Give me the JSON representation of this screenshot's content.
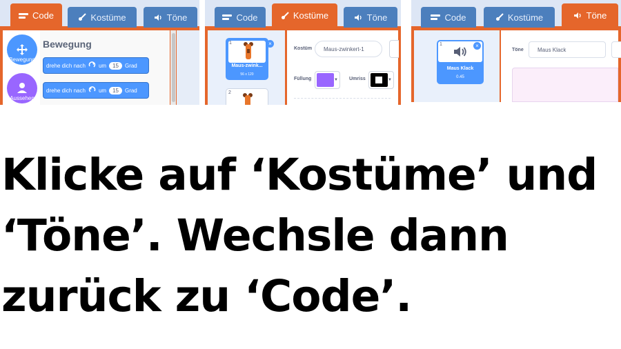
{
  "tabs": {
    "code": "Code",
    "costumes": "Kostüme",
    "sounds": "Töne"
  },
  "panel1": {
    "categories": [
      "Bewegung",
      "Aussehen"
    ],
    "section_title": "Bewegung",
    "blocks": [
      {
        "text": "drehe dich nach",
        "mid": "um",
        "value": "15",
        "unit": "Grad"
      },
      {
        "text": "drehe dich nach",
        "mid": "um",
        "value": "15",
        "unit": "Grad"
      }
    ]
  },
  "panel2": {
    "costume_label": "Kostüm",
    "costume_name": "Maus-zwinkert-1",
    "fill_label": "Füllung",
    "outline_label": "Umriss",
    "fill_color": "#9966ff",
    "outline_color": "#000000",
    "thumbs": [
      {
        "number": "1",
        "name": "Maus-zwink...",
        "size": "56 x 120"
      },
      {
        "number": "2"
      }
    ]
  },
  "panel3": {
    "sound_label": "Töne",
    "sound_name": "Maus Klack",
    "thumb": {
      "number": "1",
      "name": "Maus Klack",
      "duration": "0.45"
    }
  },
  "instruction": "Klicke auf ‘Kostüme’ und ‘Töne’. Wechsle dann zurück zu ‘Code’.",
  "colors": {
    "tab_active": "#e5662b",
    "tab_inactive": "#4c7fbd",
    "motion_blue": "#4c97ff",
    "looks_purple": "#9966ff"
  }
}
